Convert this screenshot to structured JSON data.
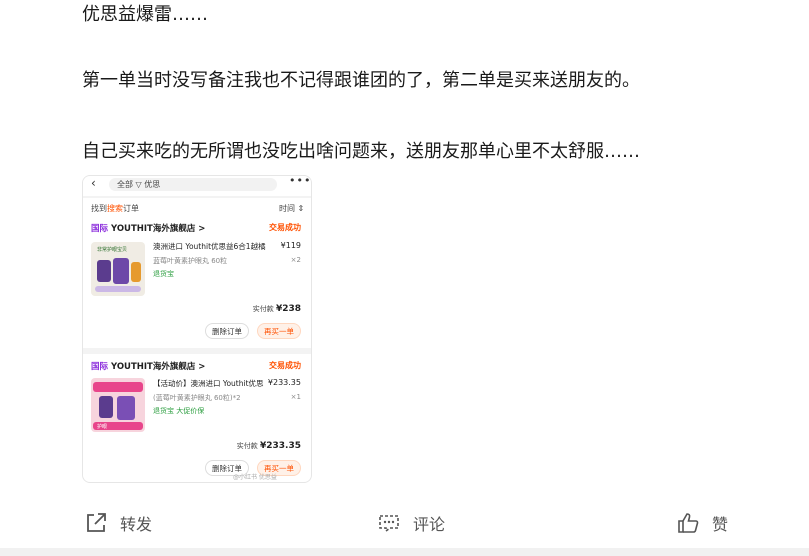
{
  "post": {
    "paragraphs": [
      "优思益爆雷……",
      "第一单当时没写备注我也不记得跟谁团的了，第二单是买来送朋友的。",
      "自己买来吃的无所谓也没吃出啥问题来，送朋友那单心里不太舒服……"
    ]
  },
  "screenshot": {
    "search_text": "全部 ▽ 优思",
    "found_prefix": "找到",
    "found_highlight": "搜索",
    "found_suffix": "订单",
    "time_filter": "时间 ⇕",
    "watermark": "@小红书 优思益",
    "orders": [
      {
        "store_tag": "国际",
        "store_name": "YOUTHIT海外旗舰店 >",
        "status": "交易成功",
        "product_name": "澳洲进口 Youthit优思益6合1越橘",
        "price": "¥119",
        "spec": "蓝莓叶黄素护眼丸 60粒",
        "qty": "×2",
        "guarantee": "退货宝",
        "paid_label": "实付款",
        "paid_amount": "¥238",
        "delete_label": "删除订单",
        "rebuy_label": "再买一单",
        "thumb_label": "非常护眼宝贝"
      },
      {
        "store_tag": "国际",
        "store_name": "YOUTHIT海外旗舰店 >",
        "status": "交易成功",
        "product_name": "【活动价】澳洲进口 Youthit优思",
        "price": "¥233.35",
        "spec": "(蓝莓叶黄素护眼丸 60粒)*2",
        "qty": "×1",
        "guarantee": "退货宝  大促价保",
        "paid_label": "实付款",
        "paid_amount": "¥233.35",
        "delete_label": "删除订单",
        "rebuy_label": "再买一单",
        "thumb_label": "护眼"
      }
    ]
  },
  "actions": {
    "share": "转发",
    "comment": "评论",
    "like": "赞"
  },
  "colors": {
    "accent_orange": "#ff5000",
    "store_tag_purple": "#8b2cdc",
    "guarantee_green": "#2a9d3e"
  }
}
